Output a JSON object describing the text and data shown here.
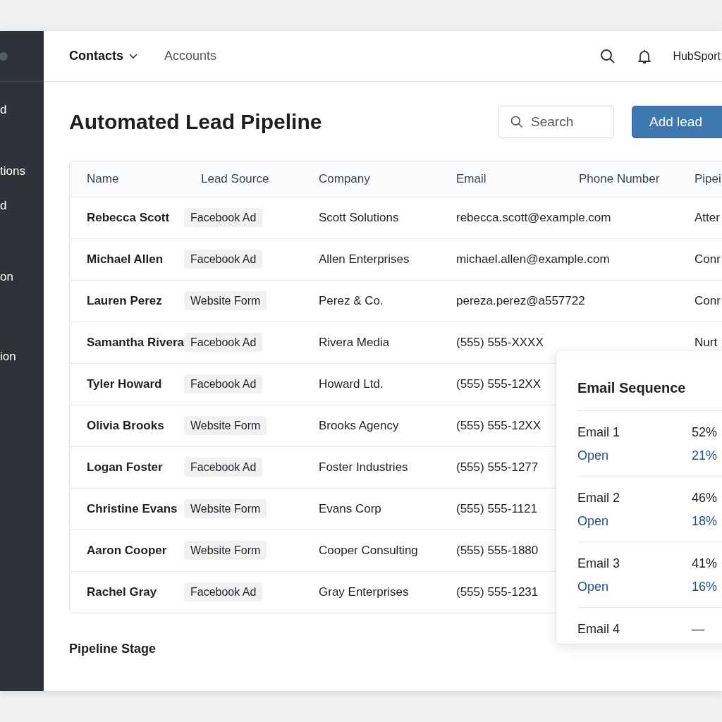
{
  "sidebar": {
    "items": [
      {
        "label": "d"
      },
      {
        "label": "tions"
      },
      {
        "label": "d"
      },
      {
        "label": "on"
      },
      {
        "label": "ion"
      }
    ]
  },
  "top_nav": {
    "tabs": [
      {
        "label": "Contacts",
        "selected": true
      },
      {
        "label": "Accounts",
        "selected": false
      }
    ],
    "account": "HubSport"
  },
  "page": {
    "title": "Automated Lead Pipeline",
    "search": {
      "placeholder": "Search"
    },
    "add_button": "Add lead"
  },
  "table": {
    "columns": [
      "Name",
      "Lead Source",
      "Company",
      "Email",
      "Phone Number",
      "Pipei"
    ],
    "rows": [
      {
        "name": "Rebecca Scott",
        "source": "Facebook Ad",
        "company": "Scott Solutions",
        "email": "rebecca.scott@example.com",
        "phone": "",
        "stage": "Atter"
      },
      {
        "name": "Michael Allen",
        "source": "Facebook Ad",
        "company": "Allen Enterprises",
        "email": "michael.allen@example.com",
        "phone": "",
        "stage": "Conr"
      },
      {
        "name": "Lauren Perez",
        "source": "Website Form",
        "company": "Perez & Co.",
        "email": "pereza.perez@a557722",
        "phone": "",
        "stage": "Conr"
      },
      {
        "name": "Samantha Rivera",
        "source": "Facebook Ad",
        "company": "Rivera Media",
        "email": "(555) 555-XXXX",
        "phone": "",
        "stage": "Nurt"
      },
      {
        "name": "Tyler Howard",
        "source": "Facebook Ad",
        "company": "Howard Ltd.",
        "email": "(555) 555-12XX",
        "phone": "",
        "stage": ""
      },
      {
        "name": "Olivia Brooks",
        "source": "Website Form",
        "company": "Brooks Agency",
        "email": "(555) 555-12XX",
        "phone": "",
        "stage": ""
      },
      {
        "name": "Logan Foster",
        "source": "Facebook Ad",
        "company": "Foster Industries",
        "email": "(555) 555-1277",
        "phone": "",
        "stage": ""
      },
      {
        "name": "Christine Evans",
        "source": "Website Form",
        "company": "Evans Corp",
        "email": "(555) 555-1121",
        "phone": "",
        "stage": ""
      },
      {
        "name": "Aaron Cooper",
        "source": "Website Form",
        "company": "Cooper Consulting",
        "email": "(555) 555-1880",
        "phone": "",
        "stage": ""
      },
      {
        "name": "Rachel Gray",
        "source": "Facebook Ad",
        "company": "Gray Enterprises",
        "email": "(555) 555-1231",
        "phone": "",
        "stage": ""
      }
    ]
  },
  "section_heading": "Pipeline Stage",
  "email_sequence": {
    "title": "Email Sequence",
    "items": [
      {
        "name": "Email 1",
        "rate": "52%",
        "open_label": "Open",
        "open_rate": "21%"
      },
      {
        "name": "Email 2",
        "rate": "46%",
        "open_label": "Open",
        "open_rate": "18%"
      },
      {
        "name": "Email 3",
        "rate": "41%",
        "open_label": "Open",
        "open_rate": "16%"
      },
      {
        "name": "Email 4",
        "rate": "—"
      }
    ]
  }
}
